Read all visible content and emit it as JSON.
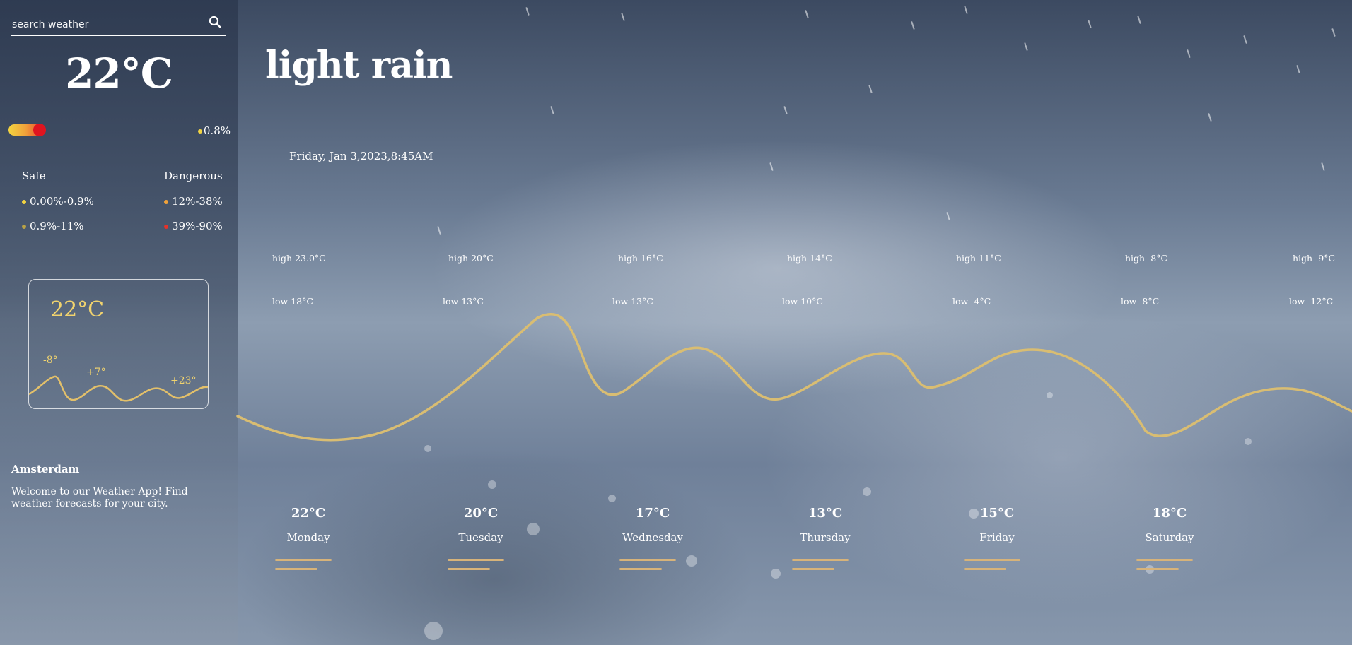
{
  "search": {
    "placeholder": "search weather"
  },
  "current": {
    "temperature": "22°C",
    "condition": "light rain",
    "datetime": "Friday, Jan 3,2023,8:45AM"
  },
  "uv": {
    "value": "0.8%",
    "level_fraction": 0.8,
    "safe_label": "Safe",
    "dangerous_label": "Dangerous",
    "safe_ranges": [
      {
        "text": "0.00%-0.9%",
        "color": "#f2d441"
      },
      {
        "text": "0.9%-11%",
        "color": "#b9a246"
      }
    ],
    "dangerous_ranges": [
      {
        "text": "12%-38%",
        "color": "#f0a23a"
      },
      {
        "text": "39%-90%",
        "color": "#e5322a"
      }
    ]
  },
  "mini_card": {
    "temperature": "22°C",
    "labels": [
      "-8°",
      "+7°",
      "+23°"
    ]
  },
  "city": "Amsterdam",
  "welcome": "Welcome to our Weather App! Find weather forecasts for your city.",
  "highs": [
    "high 23.0°C",
    "high 20°C",
    "high 16°C",
    "high 14°C",
    "high 11°C",
    "high -8°C",
    "high -9°C"
  ],
  "lows": [
    "low 18°C",
    "low 13°C",
    "low 13°C",
    "low 10°C",
    "low -4°C",
    "low -8°C",
    "low -12°C"
  ],
  "forecast": [
    {
      "temp": "22°C",
      "day": "Monday"
    },
    {
      "temp": "20°C",
      "day": "Tuesday"
    },
    {
      "temp": "17°C",
      "day": "Wednesday"
    },
    {
      "temp": "13°C",
      "day": "Thursday"
    },
    {
      "temp": "15°C",
      "day": "Friday"
    },
    {
      "temp": "18°C",
      "day": "Saturday"
    }
  ],
  "colors": {
    "accent": "#d9bd72",
    "mini_accent": "#f1d36e",
    "bar": "#d7b37a"
  }
}
